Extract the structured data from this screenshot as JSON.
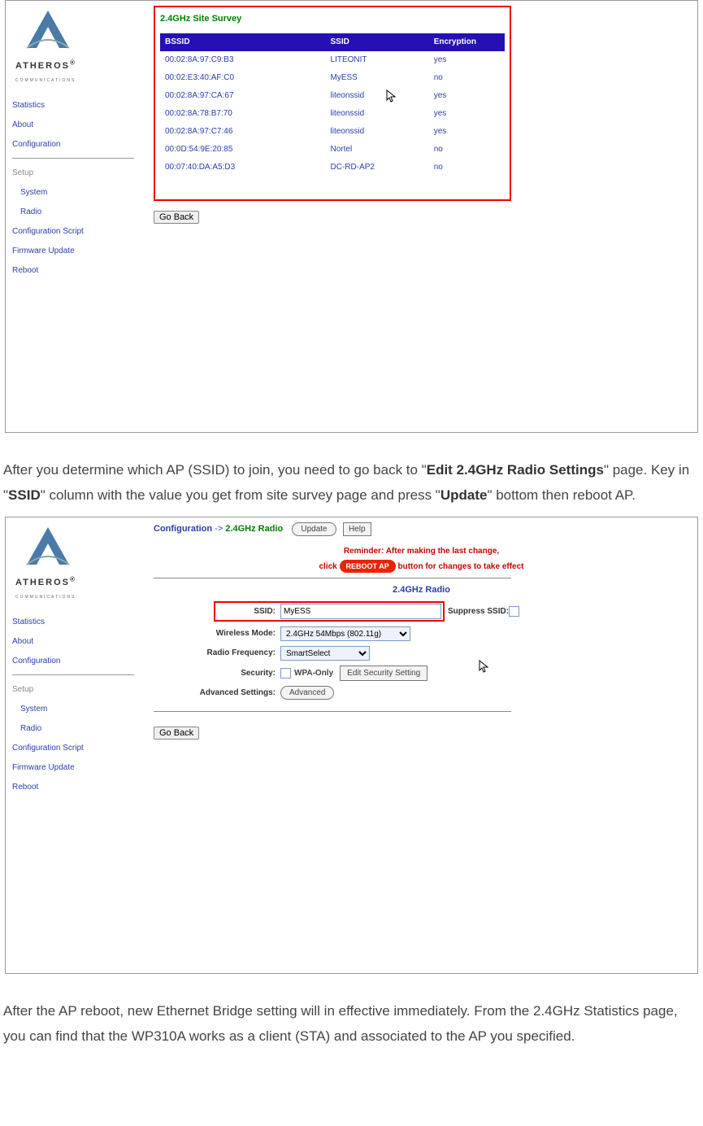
{
  "logo": {
    "brand": "ATHEROS",
    "reg": "®",
    "sub": "COMMUNICATIONS"
  },
  "nav_top": {
    "statistics": "Statistics",
    "about": "About",
    "configuration": "Configuration"
  },
  "nav_setup_label": "Setup",
  "nav_setup": {
    "system": "System",
    "radio": "Radio",
    "cfg_script": "Configuration Script",
    "fw_update": "Firmware Update",
    "reboot": "Reboot"
  },
  "survey": {
    "title": "2.4GHz Site Survey",
    "headers": {
      "bssid": "BSSID",
      "ssid": "SSID",
      "enc": "Encryption"
    },
    "rows": [
      {
        "bssid": "00:02:8A:97:C9:B3",
        "ssid": "LITEONIT",
        "enc": "yes"
      },
      {
        "bssid": "00:02:E3:40:AF:C0",
        "ssid": "MyESS",
        "enc": "no"
      },
      {
        "bssid": "00:02:8A:97:CA:67",
        "ssid": "liteonssid",
        "enc": "yes"
      },
      {
        "bssid": "00:02:8A:78:B7:70",
        "ssid": "liteonssid",
        "enc": "yes"
      },
      {
        "bssid": "00:02:8A:97:C7:46",
        "ssid": "liteonssid",
        "enc": "yes"
      },
      {
        "bssid": "00:0D:54:9E:20:85",
        "ssid": "Nortel",
        "enc": "no"
      },
      {
        "bssid": "00:07:40:DA:A5:D3",
        "ssid": "DC-RD-AP2",
        "enc": "no"
      }
    ]
  },
  "go_back": "Go Back",
  "para1": {
    "t1": "After you determine which AP (SSID) to join, you need to go back to \"",
    "b1": "Edit 2.4GHz Radio Settings",
    "t2": "\" page. Key in \"",
    "b2": "SSID",
    "t3": "\" column with the value you get from site survey page and press \"",
    "b3": "Update",
    "t4": "\" bottom then reboot AP."
  },
  "cfg": {
    "breadcrumb_cfg": "Configuration",
    "arrow": " -> ",
    "breadcrumb_radio": "2.4GHz Radio",
    "update": "Update",
    "help": "Help",
    "reminder1": "Reminder: After making the last change,",
    "reminder2a": "click ",
    "reboot_btn": "REBOOT AP",
    "reminder2b": "  button for changes to take effect",
    "section": "2.4GHz Radio",
    "ssid_label": "SSID:",
    "ssid_value": "MyESS",
    "suppress_label": "Suppress SSID:",
    "wmode_label": "Wireless Mode:",
    "wmode_value": "2.4GHz 54Mbps (802.11g)",
    "freq_label": "Radio Frequency:",
    "freq_value": "SmartSelect",
    "sec_label": "Security:",
    "wpa_only": "WPA-Only",
    "edit_sec": "Edit Security Setting",
    "adv_label": "Advanced Settings:",
    "adv_btn": "Advanced"
  },
  "para2": "After the AP reboot, new Ethernet Bridge setting will in effective immediately. From the 2.4GHz Statistics page, you can find that the WP310A works as a client (STA) and associated to the AP you specified."
}
